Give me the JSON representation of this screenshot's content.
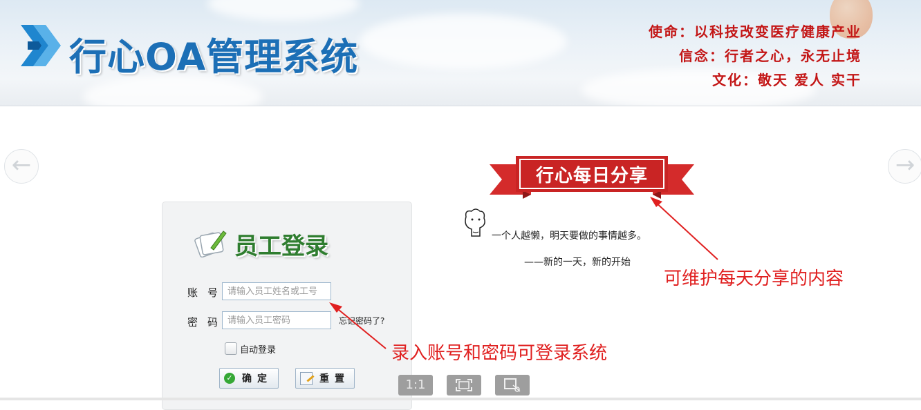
{
  "header": {
    "title": "行心OA管理系统",
    "motto": [
      "使命：以科技改变医疗健康产业",
      "信念：行者之心，永无止境",
      "文化：敬天 爱人 实干"
    ]
  },
  "login": {
    "heading": "员工登录",
    "account_label": "账号",
    "account_placeholder": "请输入员工姓名或工号",
    "password_label": "密码",
    "password_placeholder": "请输入员工密码",
    "forgot_link": "忘记密码了?",
    "auto_login_label": "自动登录",
    "confirm_button": "确定",
    "reset_button": "重置"
  },
  "share": {
    "ribbon_title": "行心每日分享",
    "quote": "一个人越懒，明天要做的事情越多。",
    "attribution": "——新的一天，新的开始"
  },
  "annotations": {
    "share_note": "可维护每天分享的内容",
    "login_note": "录入账号和密码可登录系统"
  },
  "viewer": {
    "actual_size_label": "1:1",
    "fullscreen_icon": "fullscreen-icon",
    "export_icon": "export-icon"
  },
  "colors": {
    "brand_blue": "#1c6fb6",
    "motto_red": "#c31616",
    "ribbon_red": "#d42b2b",
    "login_green": "#2f7d2f",
    "annotation_red": "#e02020"
  }
}
